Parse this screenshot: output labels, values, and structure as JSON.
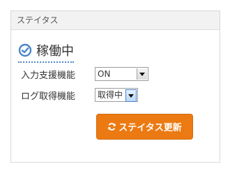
{
  "panel": {
    "title": "ステイタス"
  },
  "status": {
    "label": "稼働中",
    "icon": "check-circle-icon",
    "accent": "#4a86c5"
  },
  "settings": [
    {
      "label": "入力支援機能",
      "value": "ON"
    },
    {
      "label": "ログ取得機能",
      "value": "取得中"
    }
  ],
  "update_button": {
    "label": "ステイタス更新",
    "icon": "refresh-icon",
    "color": "#ec7a12"
  }
}
